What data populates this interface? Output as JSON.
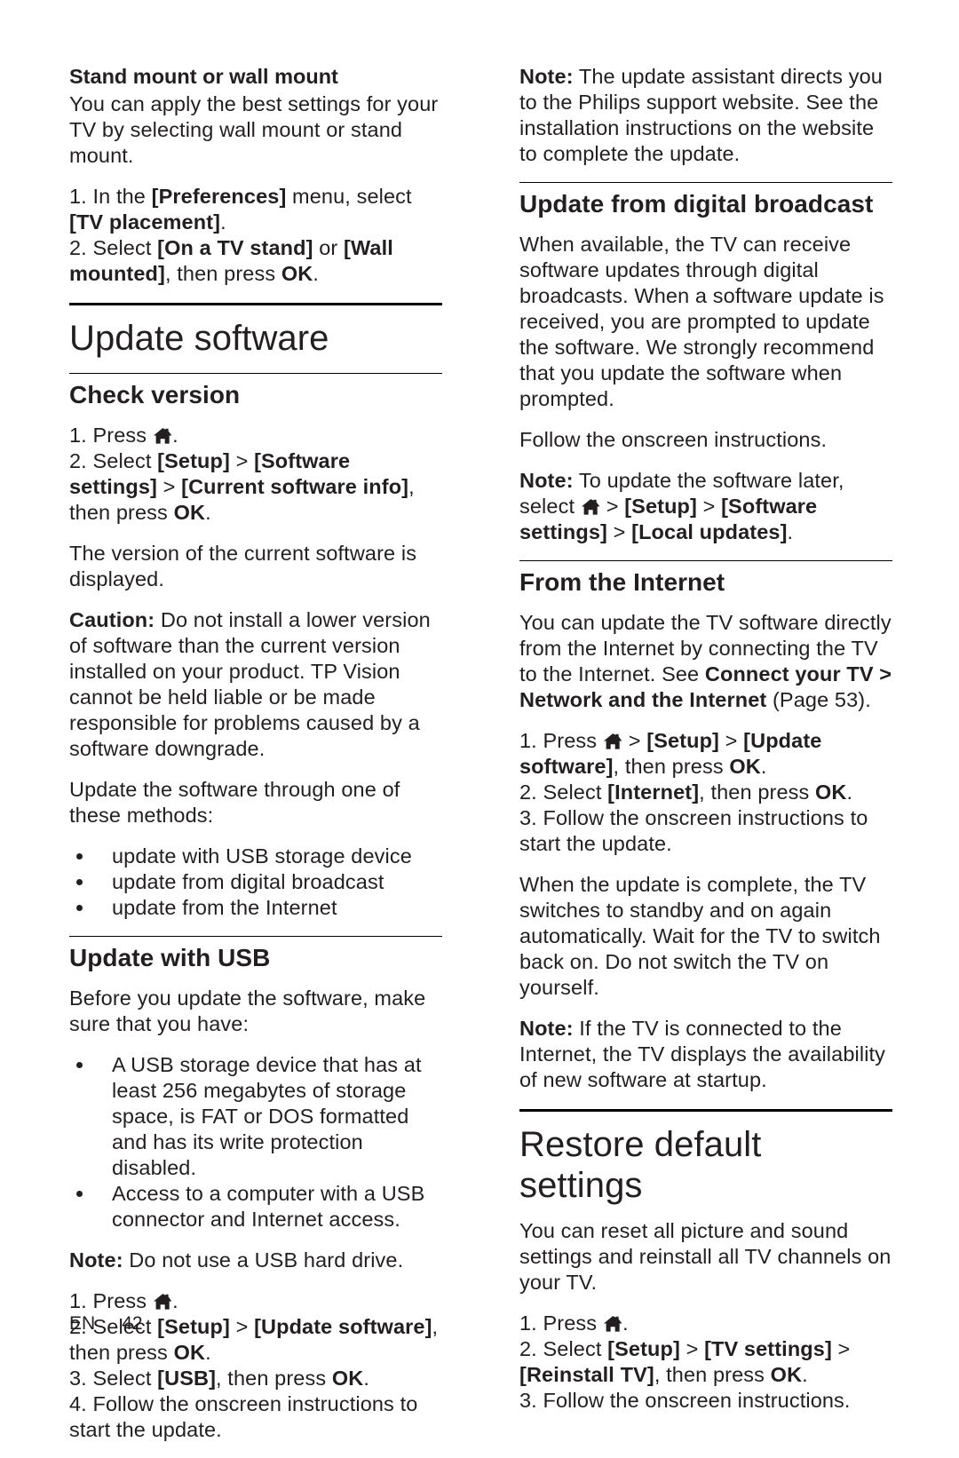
{
  "document": {
    "footer_lang": "EN",
    "footer_page": "42",
    "icon_home": "home-icon"
  },
  "left_column": {
    "stand_mount": {
      "heading": "Stand mount or wall mount",
      "intro": "You can apply the best settings for your TV by selecting wall mount or stand mount.",
      "step1_pre": "1. In the ",
      "step1_b1": "[Preferences]",
      "step1_mid": " menu, select ",
      "step1_b2": "[TV placement]",
      "step1_end": ".",
      "step2_pre": "2. Select ",
      "step2_b1": "[On a TV stand]",
      "step2_mid": " or ",
      "step2_b2": "[Wall mounted]",
      "step2_end": ", then press ",
      "step2_ok": "OK",
      "step2_period": "."
    },
    "chapter_title": "Update software",
    "check_version": {
      "heading": "Check version",
      "step1_pre": "1. Press ",
      "step1_end": ".",
      "step2_pre": "2. Select ",
      "step2_b1": "[Setup]",
      "step2_gt1": " > ",
      "step2_b2": "[Software settings]",
      "step2_gt2": " > ",
      "step2_b3": "[Current software info]",
      "step2_mid": ", then press ",
      "step2_ok": "OK",
      "step2_end": ".",
      "displayed": "The version of the current software is displayed.",
      "caution_label": "Caution:",
      "caution_text": " Do not install a lower version of software than the current version installed on your product. TP Vision cannot be held liable or be made responsible for problems caused by a software downgrade.",
      "methods_intro": "Update the software through one of these methods:",
      "methods": [
        "update with USB storage device",
        "update from digital broadcast",
        "update from the Internet"
      ]
    },
    "update_usb": {
      "heading": "Update with USB",
      "before": "Before you update the software, make sure that you have:",
      "requirements": [
        "A USB storage device that has at least 256 megabytes of storage space, is FAT or DOS formatted and has its write protection disabled.",
        "Access to a computer with a USB connector and Internet access."
      ],
      "note_label": "Note:",
      "note_text": " Do not use a USB hard drive.",
      "step1_pre": "1. Press ",
      "step1_end": ".",
      "step2_pre": "2. Select ",
      "step2_b1": "[Setup]",
      "step2_gt": " > ",
      "step2_b2": "[Update software]",
      "step2_mid": ", then press ",
      "step2_ok": "OK",
      "step2_end": ".",
      "step3_pre": "3. Select ",
      "step3_b1": "[USB]",
      "step3_mid": ", then press ",
      "step3_ok": "OK",
      "step3_end": ".",
      "step4": "4. Follow the onscreen instructions to start the update."
    }
  },
  "right_column": {
    "top_note": {
      "label": "Note:",
      "text": " The update assistant directs you to the Philips support website. See the installation instructions on the website to complete the update."
    },
    "digital_broadcast": {
      "heading": "Update from digital broadcast",
      "para1": "When available, the TV can receive software updates through digital broadcasts. When a software update is received, you are prompted to update the software. We strongly recommend that you update the software when prompted.",
      "para2": "Follow the onscreen instructions.",
      "note_label": "Note:",
      "note_pre": " To update the software later, select ",
      "note_gt1": " > ",
      "note_b1": "[Setup]",
      "note_gt2": " > ",
      "note_b2": "[Software settings]",
      "note_gt3": " > ",
      "note_b3": "[Local updates]",
      "note_end": "."
    },
    "from_internet": {
      "heading": "From the Internet",
      "para1_pre": "You can update the TV software directly from the Internet by connecting the TV to the Internet. See ",
      "para1_ref": "Connect your TV > Network and the Internet",
      "para1_page": " (Page 53).",
      "step1_pre": "1. Press ",
      "step1_gt1": " > ",
      "step1_b1": "[Setup]",
      "step1_gt2": " > ",
      "step1_b2": "[Update software]",
      "step1_mid": ", then press ",
      "step1_ok": "OK",
      "step1_end": ".",
      "step2_pre": "2. Select ",
      "step2_b1": "[Internet]",
      "step2_mid": ", then press ",
      "step2_ok": "OK",
      "step2_end": ".",
      "step3": "3. Follow the onscreen instructions to start the update.",
      "para2": "When the update is complete, the TV switches to standby and on again automatically. Wait for the TV to switch back on. Do not switch the TV on yourself.",
      "note_label": "Note:",
      "note_text": " If the TV is connected to the Internet, the TV displays the availability of new software at startup."
    },
    "restore_defaults": {
      "chapter_title": "Restore default settings",
      "para1": "You can reset all picture and sound settings and reinstall all TV channels on your TV.",
      "step1_pre": "1. Press ",
      "step1_end": ".",
      "step2_pre": "2. Select ",
      "step2_b1": "[Setup]",
      "step2_gt1": " > ",
      "step2_b2": "[TV settings]",
      "step2_gt2": " > ",
      "step2_b3": "[Reinstall TV]",
      "step2_mid": ", then press ",
      "step2_ok": "OK",
      "step2_end": ".",
      "step3": "3. Follow the onscreen instructions."
    }
  }
}
